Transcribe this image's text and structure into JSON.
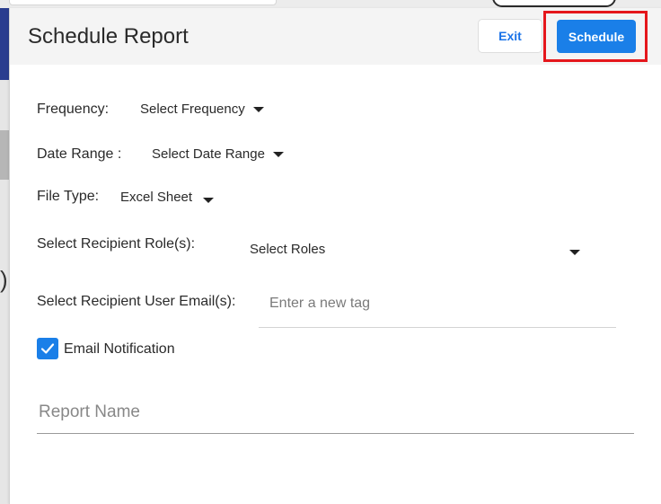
{
  "modal": {
    "title": "Schedule Report",
    "exit_label": "Exit",
    "schedule_label": "Schedule"
  },
  "form": {
    "frequency": {
      "label": "Frequency:",
      "value": "Select Frequency"
    },
    "date_range": {
      "label": "Date Range :",
      "value": "Select Date Range"
    },
    "file_type": {
      "label": "File Type:",
      "value": "Excel Sheet"
    },
    "recipient_roles": {
      "label": "Select Recipient Role(s):",
      "value": "Select Roles"
    },
    "recipient_emails": {
      "label": "Select Recipient User Email(s):",
      "placeholder": "Enter a new tag"
    },
    "email_notification": {
      "label": "Email Notification",
      "checked": true
    },
    "report_name": {
      "placeholder": "Report Name"
    }
  },
  "colors": {
    "accent": "#1a7fe8",
    "highlight": "#e5171c"
  }
}
